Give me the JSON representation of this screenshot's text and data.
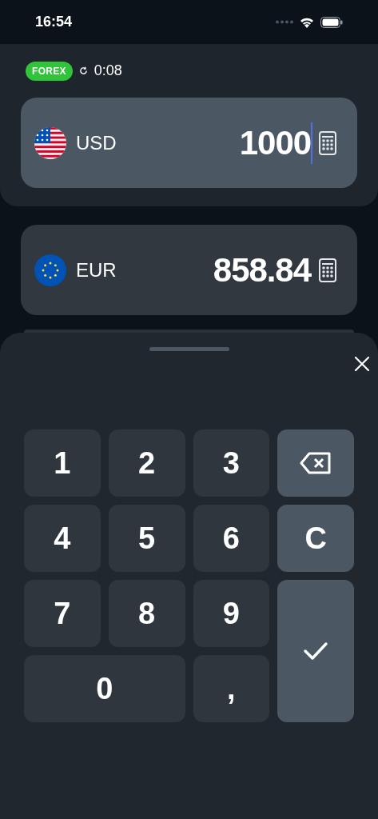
{
  "status_bar": {
    "time": "16:54"
  },
  "rate_info": {
    "badge": "FOREX",
    "refresh": "0:08"
  },
  "currencies": [
    {
      "code": "USD",
      "kind": "us",
      "amount": "1000",
      "selected": true
    },
    {
      "code": "EUR",
      "kind": "eu",
      "amount": "858.84",
      "selected": false
    }
  ],
  "keypad": {
    "keys": [
      {
        "kind": "digit",
        "label": "1"
      },
      {
        "kind": "digit",
        "label": "2"
      },
      {
        "kind": "digit",
        "label": "3"
      },
      {
        "kind": "backspace"
      },
      {
        "kind": "digit",
        "label": "4"
      },
      {
        "kind": "digit",
        "label": "5"
      },
      {
        "kind": "digit",
        "label": "6"
      },
      {
        "kind": "clear",
        "label": "C"
      },
      {
        "kind": "digit",
        "label": "7"
      },
      {
        "kind": "digit",
        "label": "8"
      },
      {
        "kind": "digit",
        "label": "9"
      },
      {
        "kind": "confirm"
      },
      {
        "kind": "zero",
        "label": "0"
      },
      {
        "kind": "digit",
        "label": ","
      }
    ]
  }
}
